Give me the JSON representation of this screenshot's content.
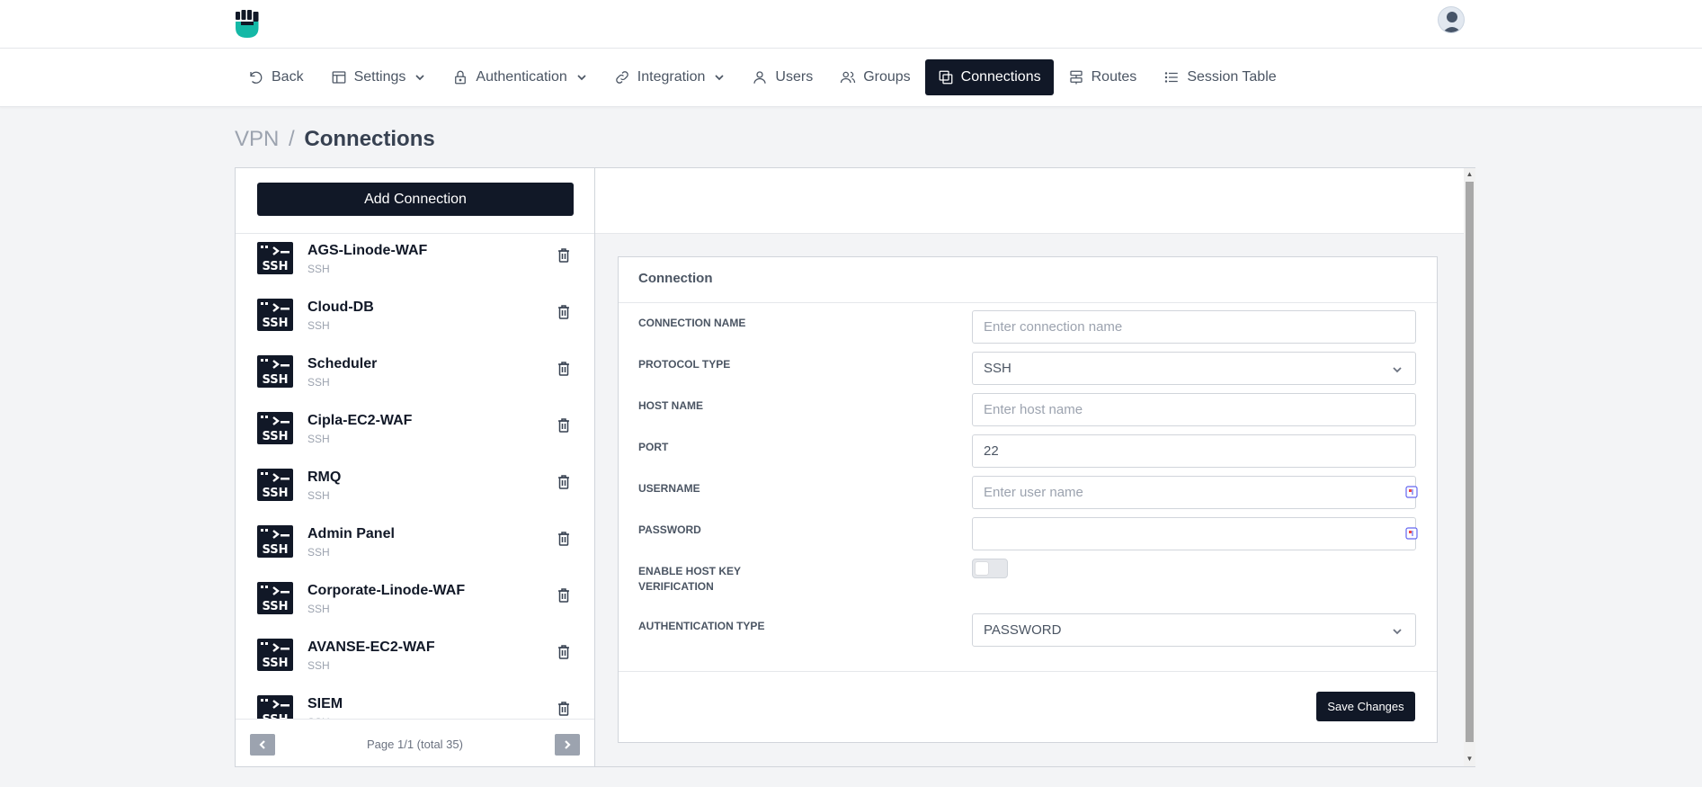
{
  "nav": {
    "items": [
      {
        "label": "Back",
        "icon": "back-icon"
      },
      {
        "label": "Settings",
        "icon": "settings-icon"
      },
      {
        "label": "Authentication",
        "icon": "lock-icon"
      },
      {
        "label": "Integration",
        "icon": "link-icon"
      },
      {
        "label": "Users",
        "icon": "user-icon"
      },
      {
        "label": "Groups",
        "icon": "groups-icon"
      },
      {
        "label": "Connections",
        "icon": "connections-icon",
        "active": true
      },
      {
        "label": "Routes",
        "icon": "routes-icon"
      },
      {
        "label": "Session Table",
        "icon": "list-icon"
      }
    ]
  },
  "breadcrumb": {
    "root": "VPN",
    "separator": "/",
    "current": "Connections"
  },
  "left": {
    "add_button": "Add Connection",
    "connections": [
      {
        "name": "AGS-Linode-WAF",
        "type": "SSH"
      },
      {
        "name": "Cloud-DB",
        "type": "SSH"
      },
      {
        "name": "Scheduler",
        "type": "SSH"
      },
      {
        "name": "Cipla-EC2-WAF",
        "type": "SSH"
      },
      {
        "name": "RMQ",
        "type": "SSH"
      },
      {
        "name": "Admin Panel",
        "type": "SSH"
      },
      {
        "name": "Corporate-Linode-WAF",
        "type": "SSH"
      },
      {
        "name": "AVANSE-EC2-WAF",
        "type": "SSH"
      },
      {
        "name": "SIEM",
        "type": "SSH"
      }
    ],
    "pagination": "Page 1/1 (total 35)"
  },
  "form": {
    "title": "Connection",
    "connection_name": {
      "label": "CONNECTION NAME",
      "placeholder": "Enter connection name",
      "value": ""
    },
    "protocol_type": {
      "label": "PROTOCOL TYPE",
      "value": "SSH"
    },
    "host_name": {
      "label": "HOST NAME",
      "placeholder": "Enter host name",
      "value": ""
    },
    "port": {
      "label": "PORT",
      "value": "22"
    },
    "username": {
      "label": "USERNAME",
      "placeholder": "Enter user name",
      "value": ""
    },
    "password": {
      "label": "PASSWORD",
      "value": ""
    },
    "host_key": {
      "label_line1": "ENABLE HOST KEY",
      "label_line2": "VERIFICATION",
      "enabled": false
    },
    "auth_type": {
      "label": "AUTHENTICATION TYPE",
      "value": "PASSWORD"
    },
    "save_button": "Save Changes"
  },
  "colors": {
    "primary_dark": "#111827",
    "muted": "#9ca3af",
    "logo_teal": "#14b8a6"
  }
}
